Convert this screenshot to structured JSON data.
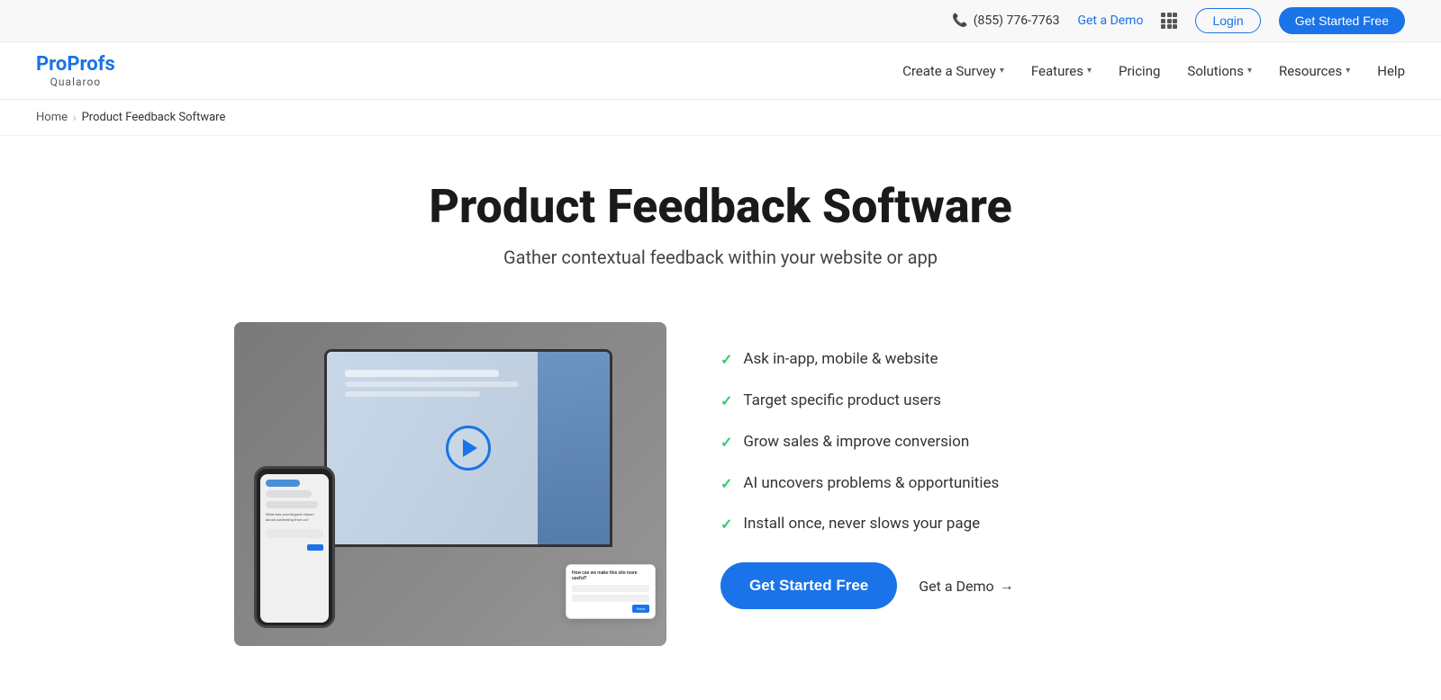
{
  "topbar": {
    "phone": "(855) 776-7763",
    "get_demo_label": "Get a Demo",
    "login_label": "Login",
    "get_started_label": "Get Started Free"
  },
  "navbar": {
    "logo_pro": "Pro",
    "logo_profs": "Profs",
    "logo_qualaroo": "Qualaroo",
    "nav_items": [
      {
        "label": "Create a Survey",
        "has_dropdown": true
      },
      {
        "label": "Features",
        "has_dropdown": true
      },
      {
        "label": "Pricing",
        "has_dropdown": false
      },
      {
        "label": "Solutions",
        "has_dropdown": true
      },
      {
        "label": "Resources",
        "has_dropdown": true
      },
      {
        "label": "Help",
        "has_dropdown": false
      }
    ]
  },
  "breadcrumb": {
    "home": "Home",
    "current": "Product Feedback Software"
  },
  "hero": {
    "title": "Product Feedback Software",
    "subtitle": "Gather contextual feedback within your website or app"
  },
  "features": [
    {
      "text": "Ask in-app, mobile & website"
    },
    {
      "text": "Target specific product users"
    },
    {
      "text": "Grow sales & improve conversion"
    },
    {
      "text": "AI uncovers problems & opportunities"
    },
    {
      "text": "Install once, never slows your page"
    }
  ],
  "cta": {
    "primary_label": "Get Started Free",
    "demo_label": "Get a Demo",
    "demo_arrow": "→"
  },
  "video": {
    "play_button_label": "Play video"
  }
}
